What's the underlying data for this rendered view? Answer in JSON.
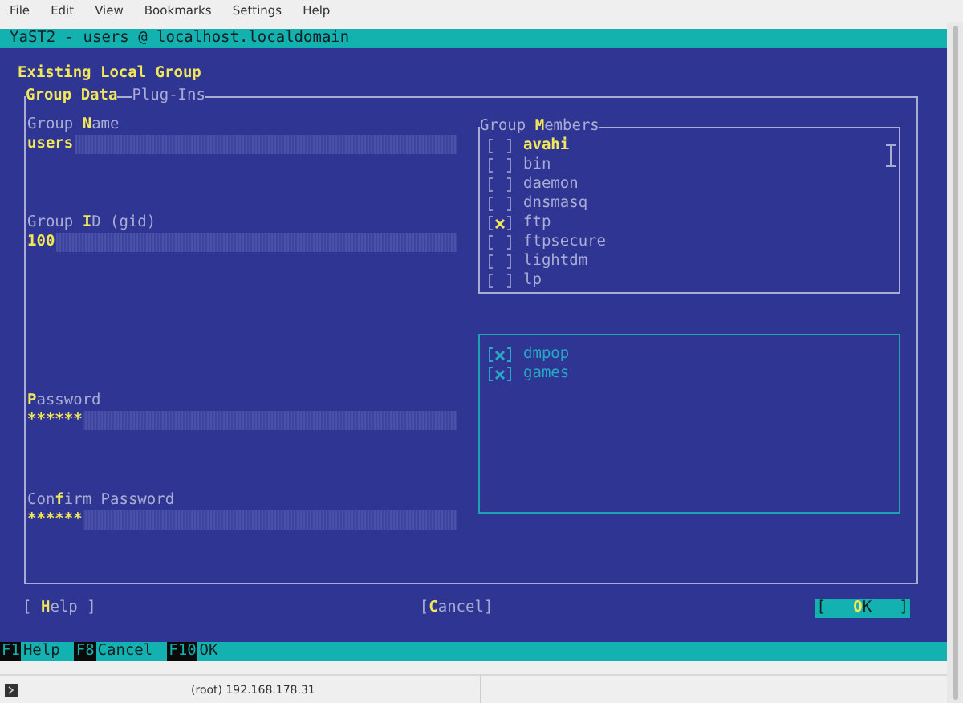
{
  "menu": [
    "File",
    "Edit",
    "View",
    "Bookmarks",
    "Settings",
    "Help"
  ],
  "terminal_title": "YaST2 - users @ localhost.localdomain",
  "heading": "Existing Local Group",
  "tabs": [
    {
      "label": "Group Data",
      "selected": true
    },
    {
      "label": "Plug-Ins",
      "selected": false
    }
  ],
  "fields": [
    {
      "label": "Group **N**ame",
      "value": "users"
    },
    {
      "label": "Group **I**D (gid)",
      "value": "100"
    },
    {
      "label": "**P**assword",
      "value": "******"
    },
    {
      "label": "Con**f**irm Password",
      "value": "******"
    }
  ],
  "members": {
    "title": "Group **M**embers",
    "items": [
      {
        "name": "avahi",
        "checked": false,
        "selected": true
      },
      {
        "name": "bin",
        "checked": false,
        "selected": false
      },
      {
        "name": "daemon",
        "checked": false,
        "selected": false
      },
      {
        "name": "dnsmasq",
        "checked": false,
        "selected": false
      },
      {
        "name": "ftp",
        "checked": true,
        "selected": false
      },
      {
        "name": "ftpsecure",
        "checked": false,
        "selected": false
      },
      {
        "name": "lightdm",
        "checked": false,
        "selected": false
      },
      {
        "name": "lp",
        "checked": false,
        "selected": false
      }
    ]
  },
  "more_members": [
    {
      "name": "dmpop",
      "checked": true
    },
    {
      "name": "games",
      "checked": true
    }
  ],
  "buttons": [
    {
      "label": "[ **H**elp ]",
      "default": false
    },
    {
      "label": "[**C**ancel]",
      "default": false
    },
    {
      "label": "[   **O**K   ]",
      "default": true
    }
  ],
  "function_keys": [
    {
      "key": "F1",
      "label": "Help"
    },
    {
      "key": "F8",
      "label": "Cancel"
    },
    {
      "key": "F10",
      "label": "OK"
    }
  ],
  "status": "(root) 192.168.178.31"
}
